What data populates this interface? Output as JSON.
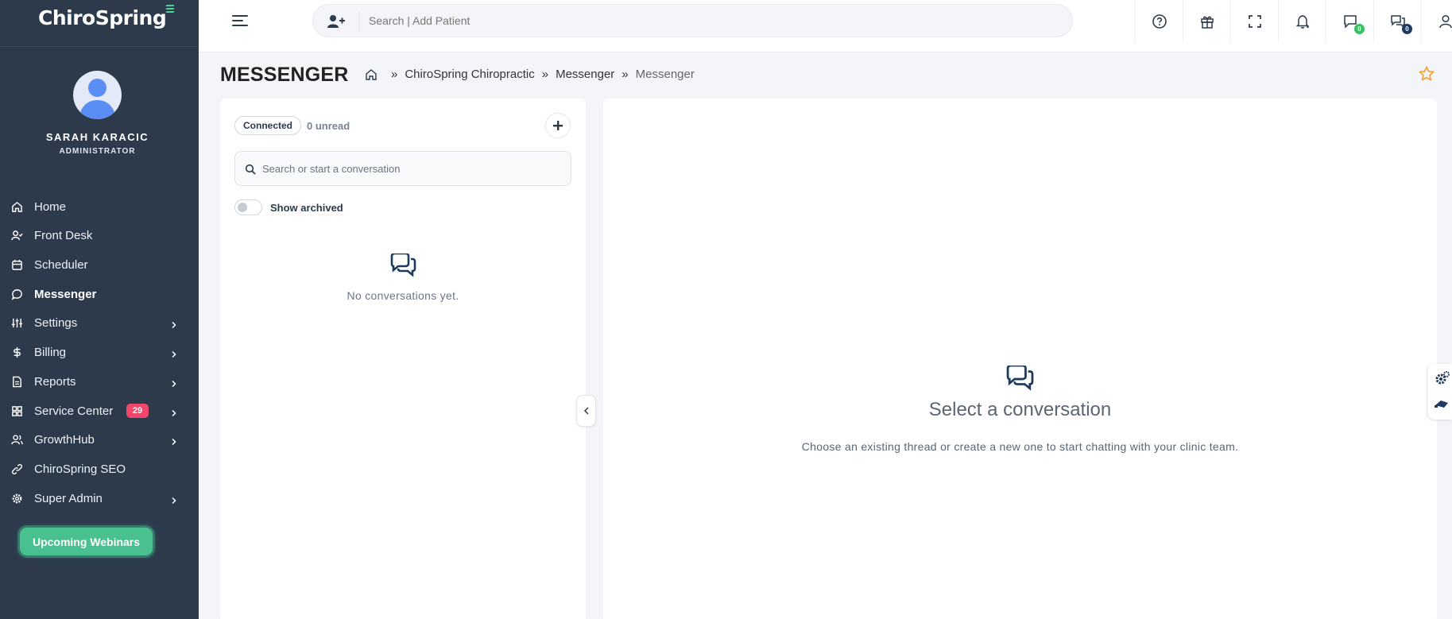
{
  "sidebar": {
    "logo": "ChiroSpring",
    "user": {
      "name": "SARAH KARACIC",
      "role": "ADMINISTRATOR"
    },
    "items": [
      {
        "label": "Home",
        "icon": "home-icon",
        "chevron": false
      },
      {
        "label": "Front Desk",
        "icon": "user-check-icon",
        "chevron": false
      },
      {
        "label": "Scheduler",
        "icon": "calendar-icon",
        "chevron": false
      },
      {
        "label": "Messenger",
        "icon": "message-circle-icon",
        "chevron": false,
        "active": true
      },
      {
        "label": "Settings",
        "icon": "sliders-icon",
        "chevron": true
      },
      {
        "label": "Billing",
        "icon": "dollar-icon",
        "chevron": true
      },
      {
        "label": "Reports",
        "icon": "file-text-icon",
        "chevron": true
      },
      {
        "label": "Service Center",
        "icon": "grid-icon",
        "chevron": true,
        "badge": "29"
      },
      {
        "label": "GrowthHub",
        "icon": "users-icon",
        "chevron": true
      },
      {
        "label": "ChiroSpring SEO",
        "icon": "link-icon",
        "chevron": false
      },
      {
        "label": "Super Admin",
        "icon": "gear-icon",
        "chevron": true
      }
    ],
    "webinar_button": "Upcoming Webinars"
  },
  "topbar": {
    "search_placeholder": "Search | Add Patient",
    "icons": [
      "help-icon",
      "gift-icon",
      "fullscreen-icon",
      "bell-icon",
      "chat-icon",
      "messages-icon",
      "user-icon"
    ],
    "chat_count": "0",
    "messages_count": "0"
  },
  "page": {
    "title": "MESSENGER",
    "breadcrumb": [
      "ChiroSpring Chiropractic",
      "Messenger",
      "Messenger"
    ],
    "breadcrumb_separator": "»"
  },
  "conversations": {
    "status": "Connected",
    "unread": "0 unread",
    "search_placeholder": "Search or start a conversation",
    "archived_toggle_label": "Show archived",
    "empty_text": "No conversations yet."
  },
  "thread": {
    "title": "Select a conversation",
    "subtitle": "Choose an existing thread or create a new one to start chatting with your clinic team."
  },
  "colors": {
    "sidebar_bg": "#2c3a4c",
    "accent_green": "#48c08f",
    "badge_red": "#f0476a",
    "star": "#f0a030"
  }
}
